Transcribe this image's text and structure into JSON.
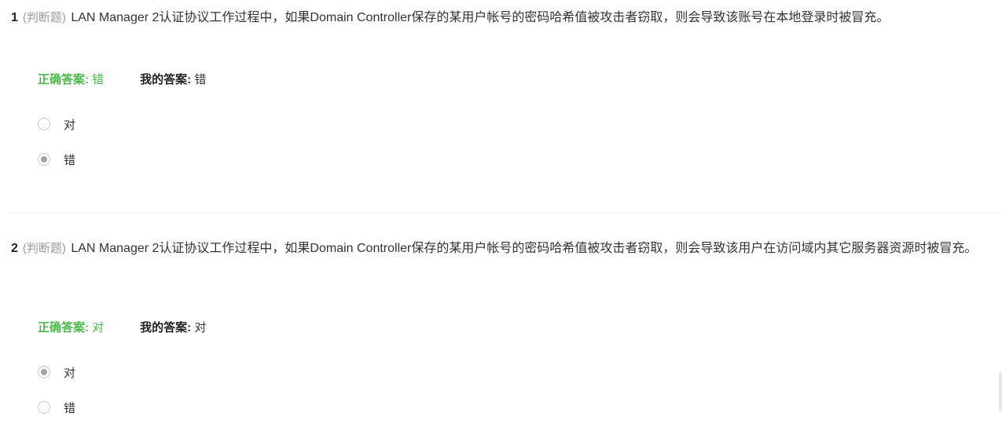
{
  "questions": [
    {
      "number": "1",
      "type_label": "(判断题)",
      "text": "LAN Manager 2认证协议工作过程中，如果Domain Controller保存的某用户帐号的密码哈希值被攻击者窃取，则会导致该账号在本地登录时被冒充。",
      "correct_answer_label": "正确答案:",
      "correct_answer_value": "错",
      "my_answer_label": "我的答案:",
      "my_answer_value": "错",
      "options": [
        {
          "label": "对",
          "selected": false
        },
        {
          "label": "错",
          "selected": true
        }
      ]
    },
    {
      "number": "2",
      "type_label": "(判断题)",
      "text": "LAN Manager 2认证协议工作过程中，如果Domain Controller保存的某用户帐号的密码哈希值被攻击者窃取，则会导致该用户在访问域内其它服务器资源时被冒充。",
      "correct_answer_label": "正确答案:",
      "correct_answer_value": "对",
      "my_answer_label": "我的答案:",
      "my_answer_value": "对",
      "options": [
        {
          "label": "对",
          "selected": true
        },
        {
          "label": "错",
          "selected": false
        }
      ]
    }
  ],
  "colors": {
    "correct_green": "#4cb84c",
    "type_gray": "#9a9a9a",
    "text": "#333333",
    "radio_dot": "#a3a3a3",
    "divider": "#eeeeee"
  }
}
